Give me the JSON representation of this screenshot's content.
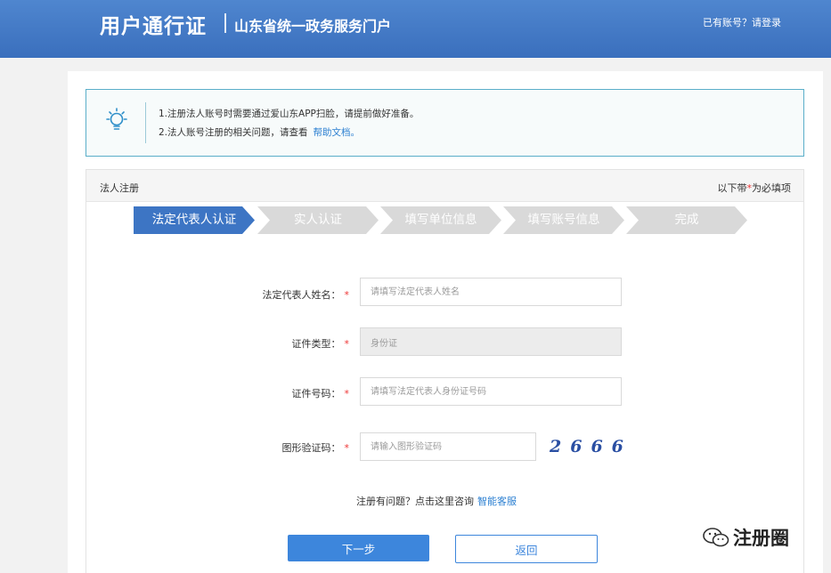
{
  "header": {
    "brand": "用户通行证",
    "subtitle": "山东省统一政务服务门户",
    "login_link": "已有账号？请登录"
  },
  "notice": {
    "icon": "lightbulb-icon",
    "line1": "1.注册法人账号时需要通过爱山东APP扫脸，请提前做好准备。",
    "line2": "2.法人账号注册的相关问题，请查看",
    "help_link": "帮助文档。"
  },
  "panel": {
    "title": "法人注册",
    "hint_prefix": "以下带",
    "hint_star": "*",
    "hint_suffix": "为必填项"
  },
  "steps": [
    {
      "label": "法定代表人认证",
      "active": true
    },
    {
      "label": "实人认证",
      "active": false
    },
    {
      "label": "填写单位信息",
      "active": false
    },
    {
      "label": "填写账号信息",
      "active": false
    },
    {
      "label": "完成",
      "active": false
    }
  ],
  "form": {
    "name_label": "法定代表人姓名：",
    "name_placeholder": "请填写法定代表人姓名",
    "id_type_label": "证件类型：",
    "id_type_value": "身份证",
    "id_number_label": "证件号码：",
    "id_number_placeholder": "请填写法定代表人身份证号码",
    "captcha_label": "图形验证码：",
    "captcha_placeholder": "请输入图形验证码",
    "captcha_image_text": "2666",
    "required_mark": "*"
  },
  "help": {
    "text": "注册有问题？点击这里咨询",
    "link": "智能客服"
  },
  "buttons": {
    "next": "下一步",
    "back": "返回"
  },
  "watermark": {
    "icon": "wechat-icon",
    "text": "注册圈"
  },
  "colors": {
    "header_blue": "#3a6fbd",
    "step_active": "#3d75c4",
    "step_inactive": "#d9d9d9",
    "link_blue": "#2b7fd1",
    "required_red": "#e33333"
  }
}
